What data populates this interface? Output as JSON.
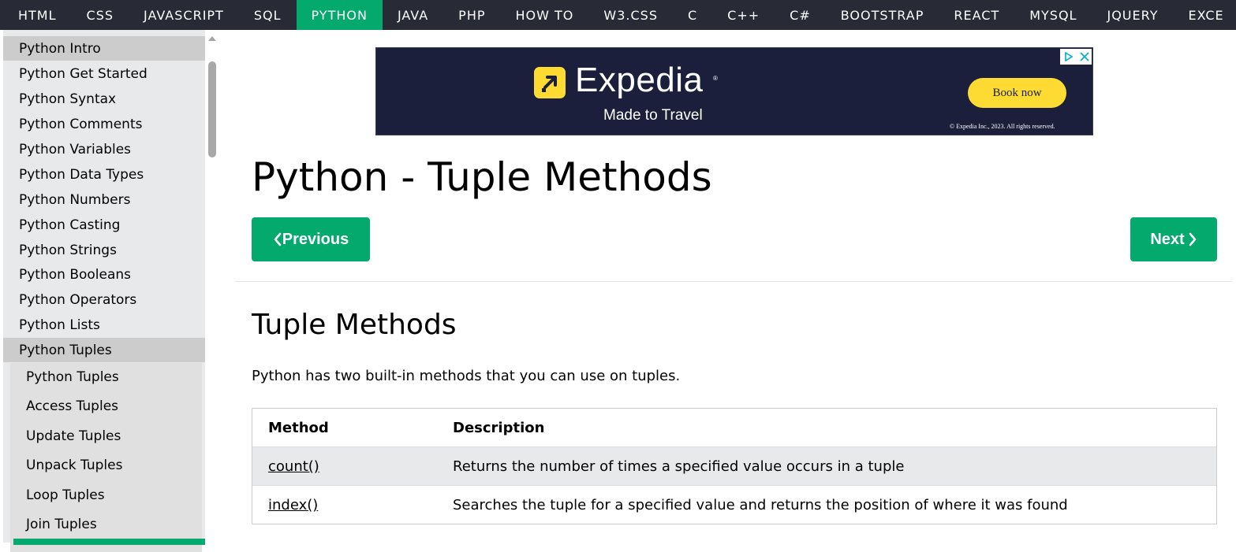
{
  "topnav": {
    "items": [
      "HTML",
      "CSS",
      "JAVASCRIPT",
      "SQL",
      "PYTHON",
      "JAVA",
      "PHP",
      "HOW TO",
      "W3.CSS",
      "C",
      "C++",
      "C#",
      "BOOTSTRAP",
      "REACT",
      "MYSQL",
      "JQUERY",
      "EXCE"
    ],
    "active": "PYTHON",
    "colors": {
      "background": "#282a35",
      "active": "#04aa6d"
    }
  },
  "sidebar": {
    "items": [
      "Python Intro",
      "Python Get Started",
      "Python Syntax",
      "Python Comments",
      "Python Variables",
      "Python Data Types",
      "Python Numbers",
      "Python Casting",
      "Python Strings",
      "Python Booleans",
      "Python Operators",
      "Python Lists",
      "Python Tuples"
    ],
    "sub_items": [
      "Python Tuples",
      "Access Tuples",
      "Update Tuples",
      "Unpack Tuples",
      "Loop Tuples",
      "Join Tuples"
    ]
  },
  "ad": {
    "brand": "Expedia",
    "registered_mark": "®",
    "tagline": "Made to Travel",
    "cta": "Book now",
    "copyright": "© Expedia Inc., 2023. All rights reserved.",
    "colors": {
      "background": "#1b1f3b",
      "accent": "#fddb32"
    }
  },
  "main": {
    "title": "Python - Tuple Methods",
    "prev_label": "Previous",
    "next_label": "Next",
    "section_title": "Tuple Methods",
    "intro": "Python has two built-in methods that you can use on tuples.",
    "table": {
      "headers": [
        "Method",
        "Description"
      ],
      "rows": [
        [
          "count()",
          "Returns the number of times a specified value occurs in a tuple"
        ],
        [
          "index()",
          "Searches the tuple for a specified value and returns the position of where it was found"
        ]
      ]
    },
    "colors": {
      "button": "#04aa6d"
    }
  }
}
